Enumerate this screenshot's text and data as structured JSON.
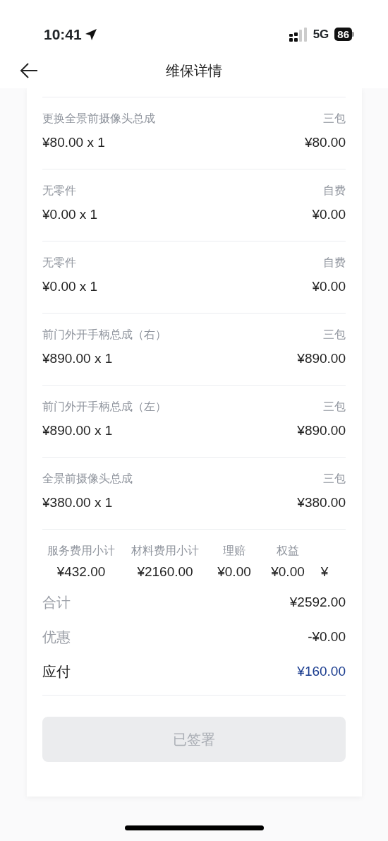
{
  "status_bar": {
    "time": "10:41",
    "network": "5G",
    "battery": "86"
  },
  "header": {
    "title": "维保详情"
  },
  "items": [
    {
      "name": "更换全景前摄像头总成",
      "tag": "三包",
      "price": "¥80.00 x 1",
      "amount": "¥80.00"
    },
    {
      "name": "无零件",
      "tag": "自费",
      "price": "¥0.00 x 1",
      "amount": "¥0.00"
    },
    {
      "name": "无零件",
      "tag": "自费",
      "price": "¥0.00 x 1",
      "amount": "¥0.00"
    },
    {
      "name": "前门外开手柄总成（右）",
      "tag": "三包",
      "price": "¥890.00 x 1",
      "amount": "¥890.00"
    },
    {
      "name": "前门外开手柄总成（左）",
      "tag": "三包",
      "price": "¥890.00 x 1",
      "amount": "¥890.00"
    },
    {
      "name": "全景前摄像头总成",
      "tag": "三包",
      "price": "¥380.00 x 1",
      "amount": "¥380.00"
    }
  ],
  "subtotals": [
    {
      "label": "服务费用小计",
      "value": "¥432.00"
    },
    {
      "label": "材料费用小计",
      "value": "¥2160.00"
    },
    {
      "label": "理赔",
      "value": "¥0.00"
    },
    {
      "label": "权益",
      "value": "¥0.00"
    },
    {
      "value": "¥"
    }
  ],
  "totals": [
    {
      "kind": "muted",
      "label": "合计",
      "value": "¥2592.00"
    },
    {
      "kind": "muted",
      "label": "优惠",
      "value": "-¥0.00"
    },
    {
      "kind": "due",
      "label": "应付",
      "value": "¥160.00"
    }
  ],
  "sign_button": {
    "label": "已签署",
    "disabled": true
  }
}
